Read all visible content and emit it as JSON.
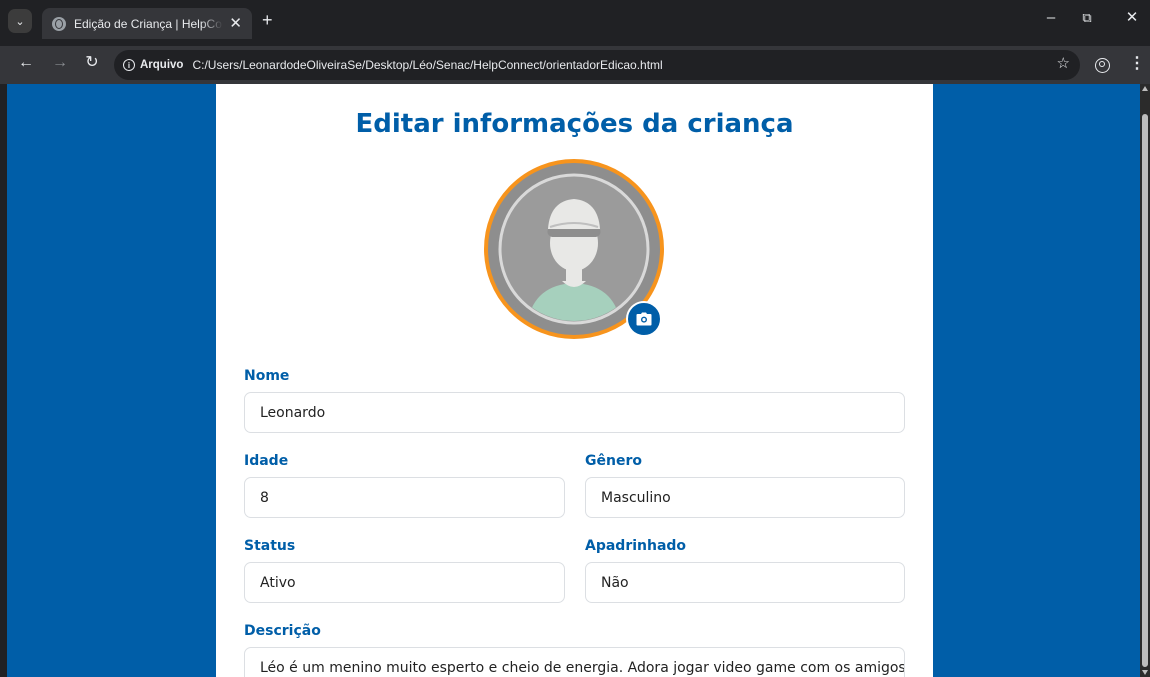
{
  "browser": {
    "tab_title": "Edição de Criança | HelpConnect",
    "omnibox_chip": "Arquivo",
    "url": "C:/Users/LeonardodeOliveiraSe/Desktop/Léo/Senac/HelpConnect/orientadorEdicao.html"
  },
  "page": {
    "title": "Editar informações da criança",
    "fields": {
      "nome": {
        "label": "Nome",
        "value": "Leonardo"
      },
      "idade": {
        "label": "Idade",
        "value": "8"
      },
      "genero": {
        "label": "Gênero",
        "value": "Masculino"
      },
      "status": {
        "label": "Status",
        "value": "Ativo"
      },
      "apadrinhado": {
        "label": "Apadrinhado",
        "value": "Não"
      },
      "descricao": {
        "label": "Descrição",
        "value": "Léo é um menino muito esperto e cheio de energia. Adora jogar video game com os amigos e"
      }
    }
  },
  "colors": {
    "brand_blue": "#005ea8",
    "avatar_ring": "#f7941d"
  },
  "icons": {
    "camera": "camera-icon",
    "avatar": "default-child-avatar"
  }
}
